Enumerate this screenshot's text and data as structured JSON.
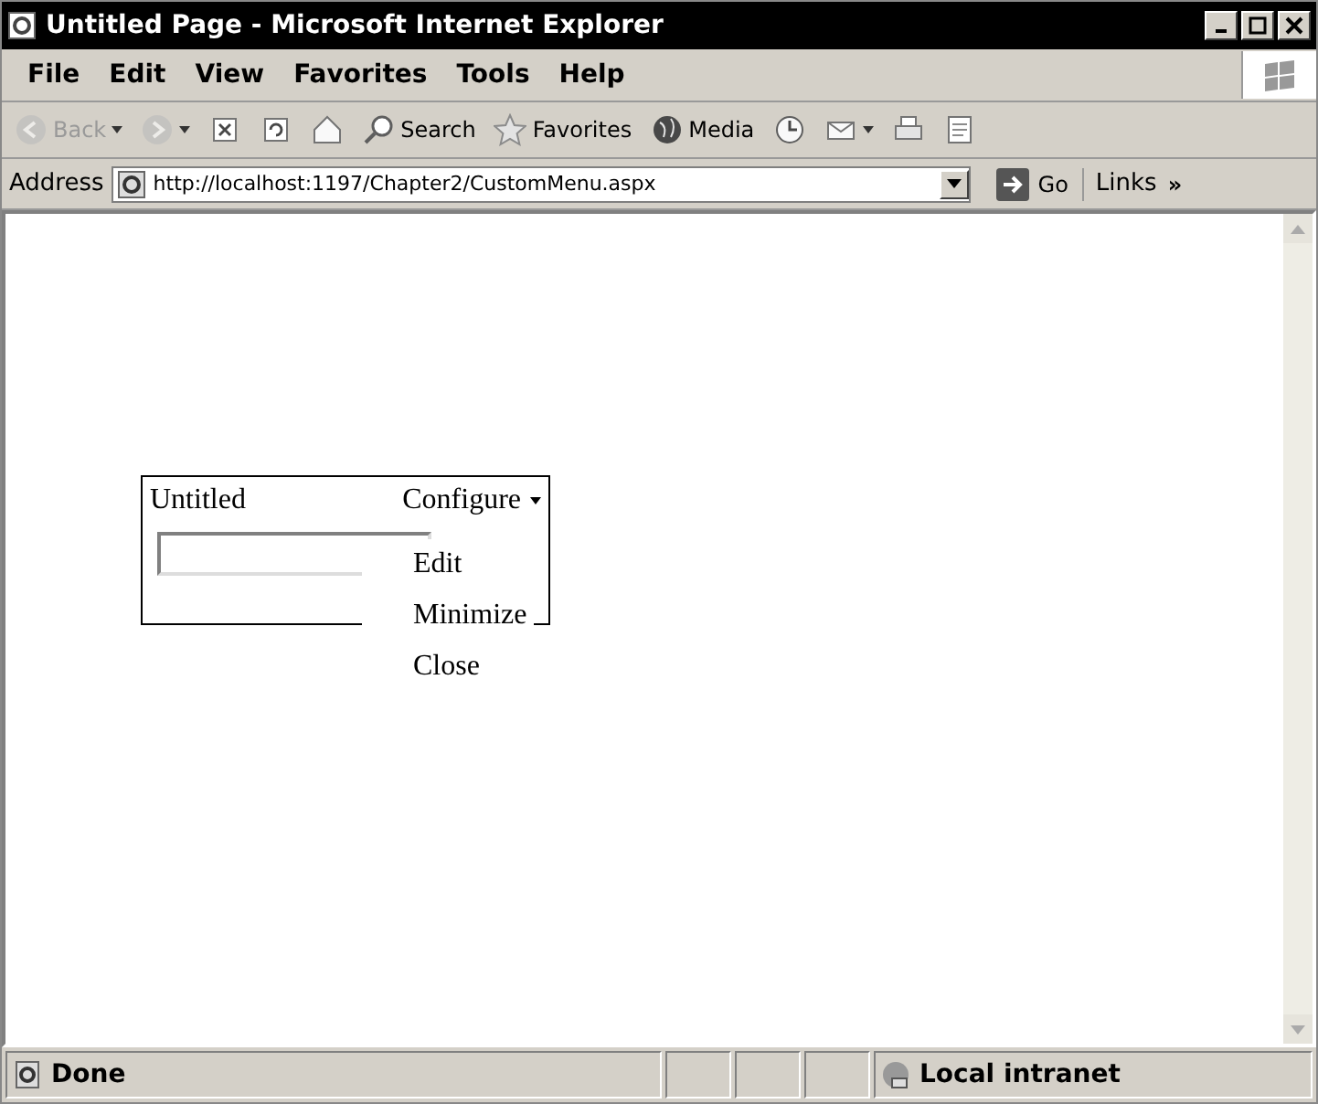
{
  "window": {
    "title": "Untitled Page - Microsoft Internet Explorer"
  },
  "menu": [
    "File",
    "Edit",
    "View",
    "Favorites",
    "Tools",
    "Help"
  ],
  "toolbar": [
    {
      "kind": "back",
      "label": "Back",
      "disabled": true
    },
    {
      "kind": "forward",
      "disabled": true
    },
    {
      "kind": "stop",
      "disabled": false
    },
    {
      "kind": "refresh",
      "disabled": false
    },
    {
      "kind": "home",
      "disabled": false
    },
    {
      "kind": "search",
      "label": "Search",
      "disabled": false
    },
    {
      "kind": "favorites",
      "label": "Favorites",
      "disabled": false
    },
    {
      "kind": "media",
      "label": "Media",
      "disabled": false
    },
    {
      "kind": "history",
      "disabled": false
    },
    {
      "kind": "mail",
      "disabled": false
    },
    {
      "kind": "print",
      "disabled": false
    },
    {
      "kind": "edit",
      "disabled": false
    }
  ],
  "address": {
    "label": "Address",
    "value": "http://localhost:1197/Chapter2/CustomMenu.aspx",
    "go": "Go",
    "links": "Links",
    "more": "»"
  },
  "webpart": {
    "title": "Untitled",
    "verbs_button": "Configure",
    "verbs_open": true,
    "verbs": [
      "Edit",
      "Minimize",
      "Close"
    ]
  },
  "status_bar": {
    "text": "Done",
    "zone": "Local intranet"
  }
}
